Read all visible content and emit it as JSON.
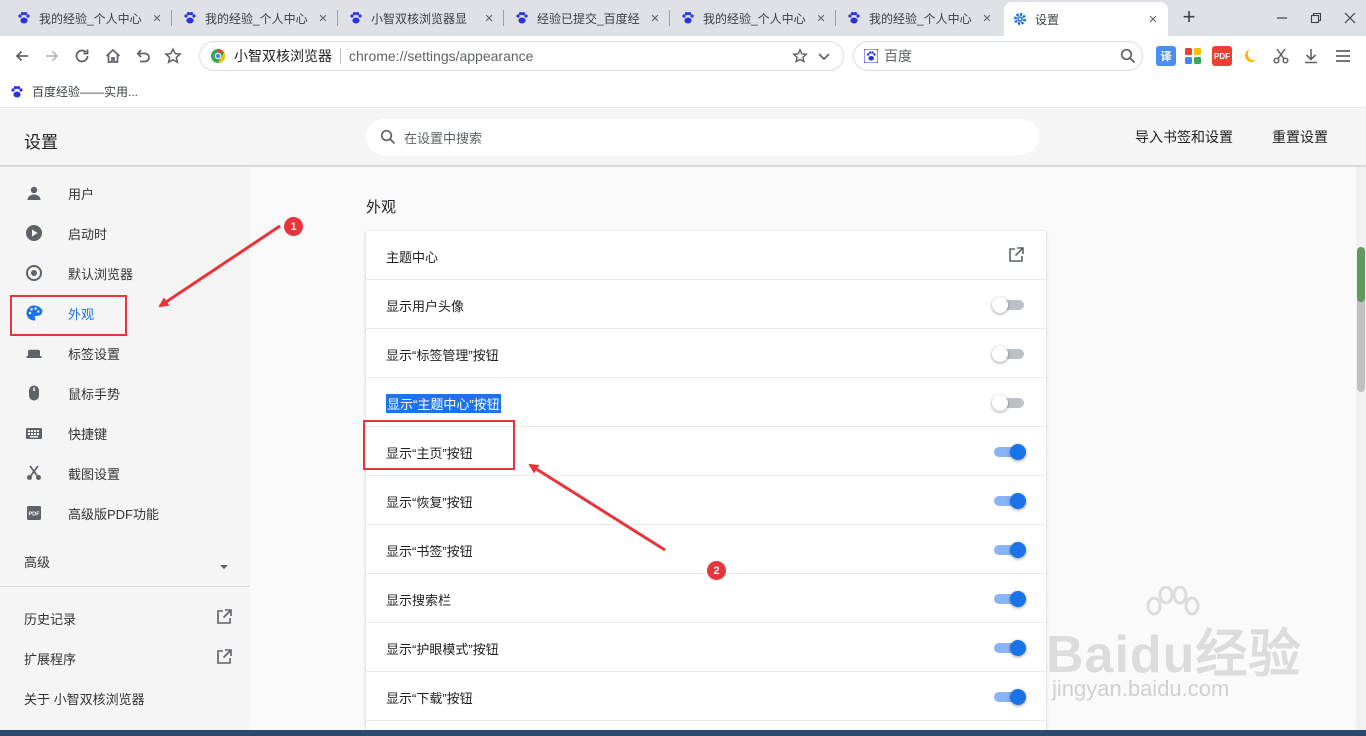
{
  "tabs": [
    {
      "label": "我的经验_个人中心",
      "active": false
    },
    {
      "label": "我的经验_个人中心",
      "active": false
    },
    {
      "label": "小智双核浏览器显",
      "active": false
    },
    {
      "label": "经验已提交_百度经",
      "active": false
    },
    {
      "label": "我的经验_个人中心",
      "active": false
    },
    {
      "label": "我的经验_个人中心",
      "active": false
    },
    {
      "label": "设置",
      "active": true
    }
  ],
  "toolbar": {
    "browser_name": "小智双核浏览器",
    "url": "chrome://settings/appearance",
    "search_engine": "百度"
  },
  "bookmarks": [
    {
      "label": "百度经验——实用..."
    }
  ],
  "settings": {
    "title": "设置",
    "search_placeholder": "在设置中搜索",
    "import_label": "导入书签和设置",
    "reset_label": "重置设置"
  },
  "sidebar": {
    "items": [
      {
        "label": "用户",
        "icon": "person-icon"
      },
      {
        "label": "启动时",
        "icon": "play-icon"
      },
      {
        "label": "默认浏览器",
        "icon": "target-icon"
      },
      {
        "label": "外观",
        "icon": "palette-icon",
        "active": true
      },
      {
        "label": "标签设置",
        "icon": "tab-icon"
      },
      {
        "label": "鼠标手势",
        "icon": "mouse-icon"
      },
      {
        "label": "快捷键",
        "icon": "keyboard-icon"
      },
      {
        "label": "截图设置",
        "icon": "scissors-icon"
      },
      {
        "label": "高级版PDF功能",
        "icon": "pdf-icon"
      }
    ],
    "advanced_label": "高级",
    "bottom_items": [
      {
        "label": "历史记录",
        "external": true
      },
      {
        "label": "扩展程序",
        "external": true
      },
      {
        "label": "关于 小智双核浏览器",
        "external": false
      }
    ]
  },
  "main": {
    "section_title": "外观",
    "rows": [
      {
        "label": "主题中心",
        "control": "external-link"
      },
      {
        "label": "显示用户头像",
        "control": "toggle",
        "on": false
      },
      {
        "label": "显示“标签管理”按钮",
        "control": "toggle",
        "on": false
      },
      {
        "label": "显示“主题中心”按钮",
        "control": "toggle",
        "on": false,
        "selected": true
      },
      {
        "label": "显示“主页”按钮",
        "control": "toggle",
        "on": true
      },
      {
        "label": "显示“恢复”按钮",
        "control": "toggle",
        "on": true
      },
      {
        "label": "显示“书签”按钮",
        "control": "toggle",
        "on": true
      },
      {
        "label": "显示搜索栏",
        "control": "toggle",
        "on": true
      },
      {
        "label": "显示“护眼模式”按钮",
        "control": "toggle",
        "on": true
      },
      {
        "label": "显示“下载”按钮",
        "control": "toggle",
        "on": true
      }
    ]
  },
  "annotations": [
    {
      "number": "1"
    },
    {
      "number": "2"
    }
  ],
  "watermark": {
    "brand": "Baidu经验",
    "url": "jingyan.baidu.com"
  },
  "colors": {
    "accent": "#1a73e8",
    "annotation": "#e8343a",
    "toggle_on_track": "#8ab4f8"
  }
}
